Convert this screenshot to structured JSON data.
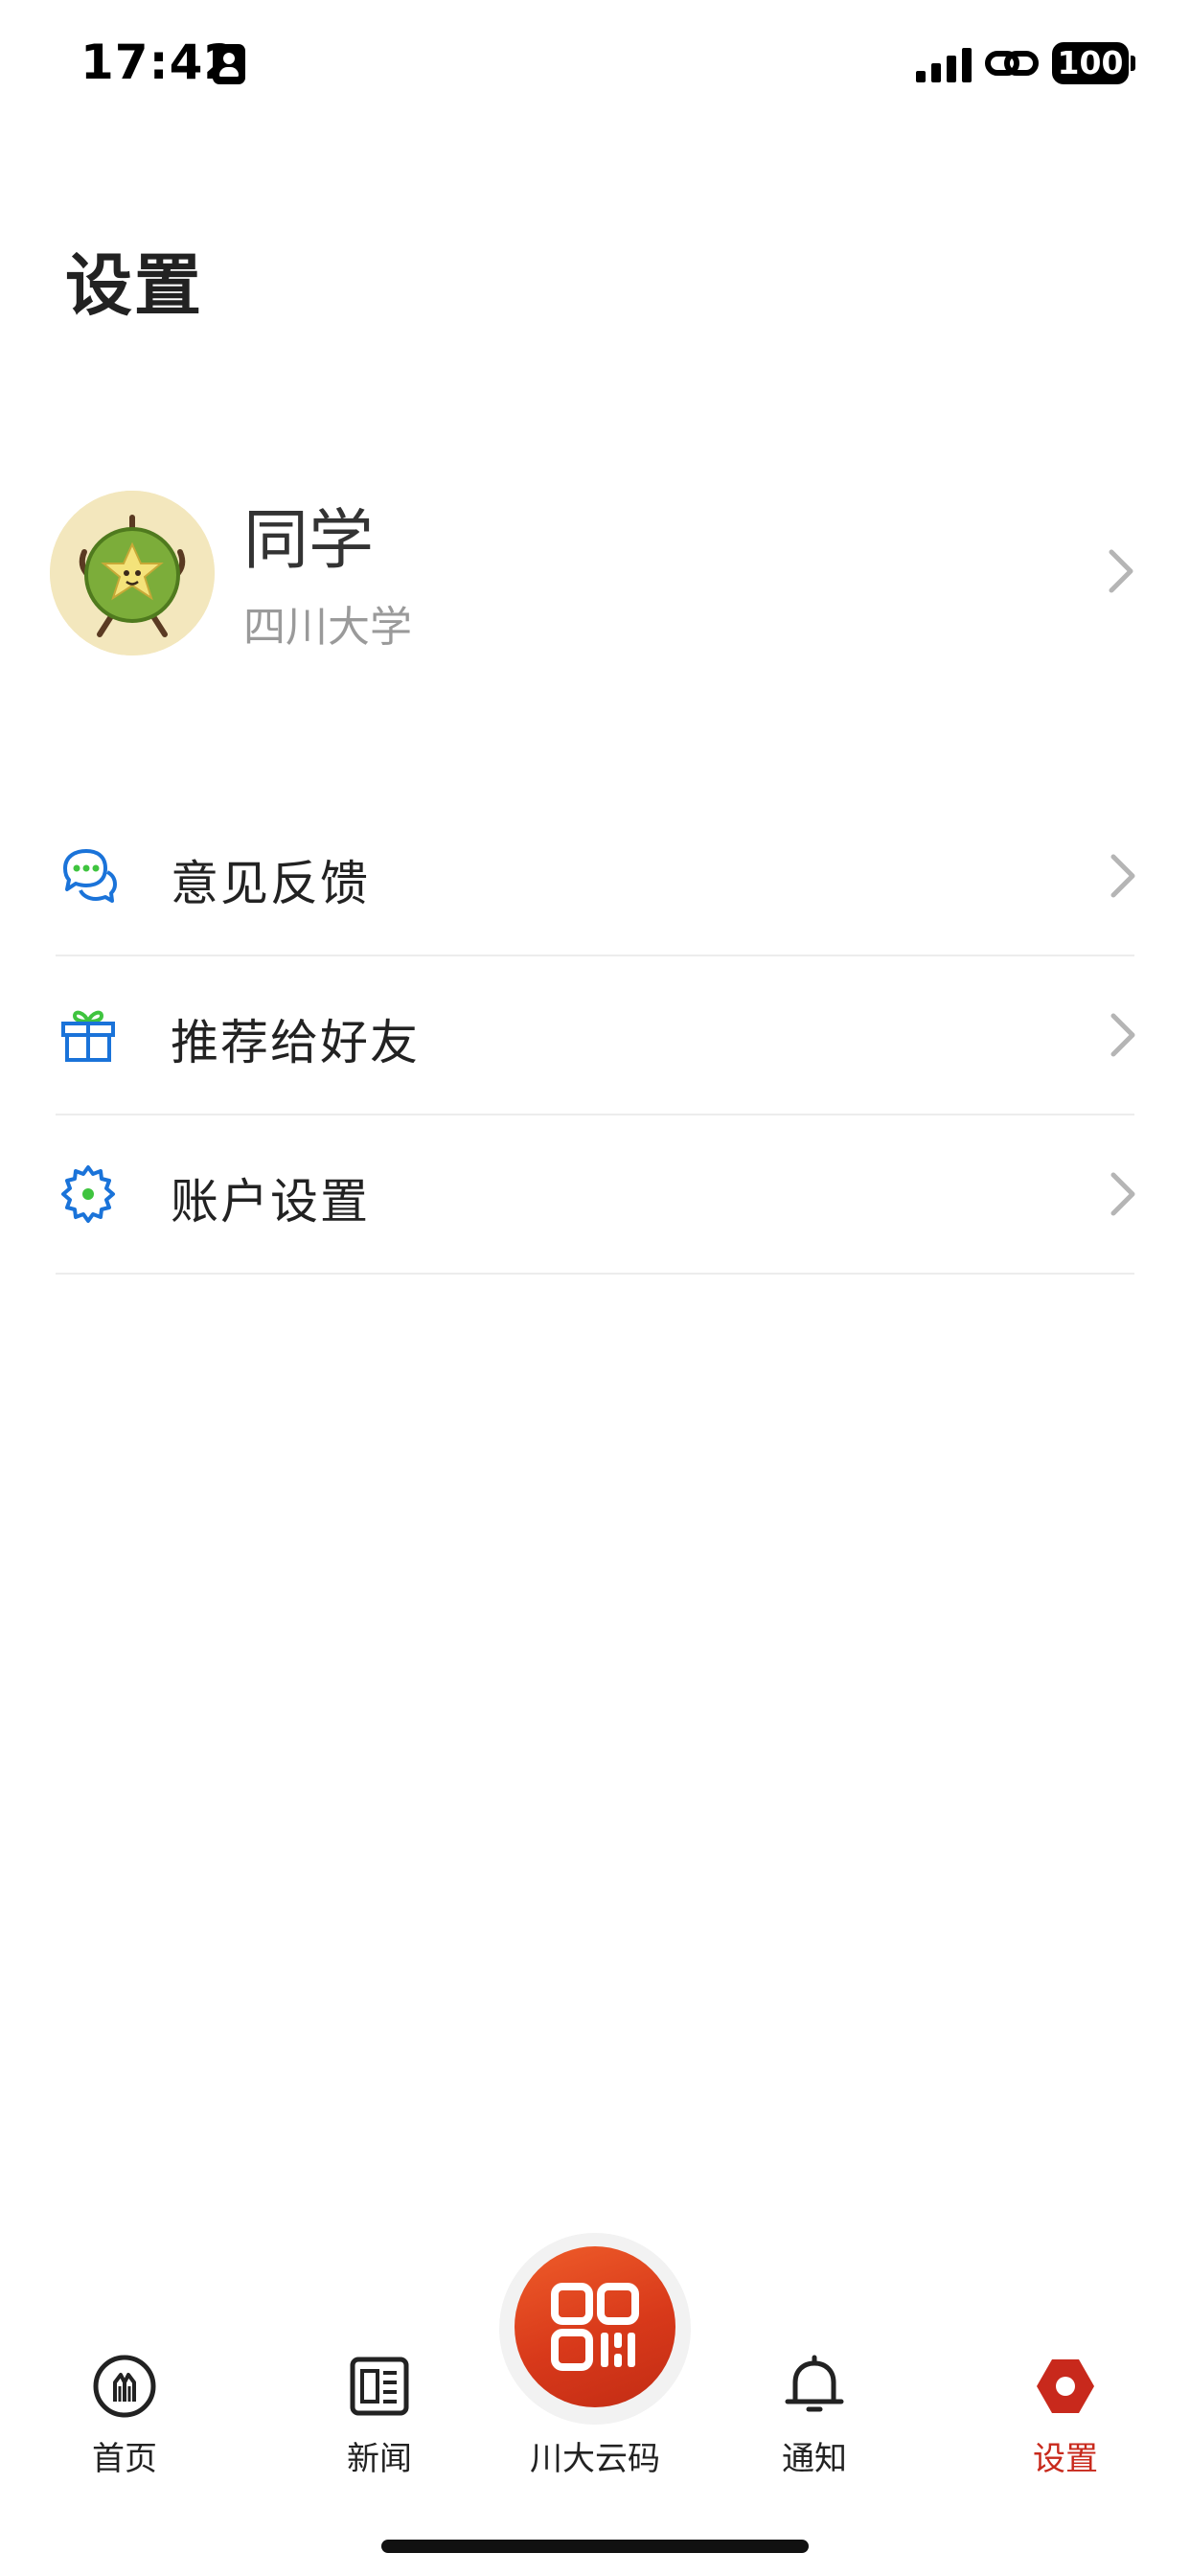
{
  "status_bar": {
    "time": "17:42",
    "battery": "100"
  },
  "page": {
    "title": "设置"
  },
  "profile": {
    "name": "同学",
    "school": "四川大学"
  },
  "menu": [
    {
      "label": "意见反馈",
      "icon": "chat-bubbles-icon"
    },
    {
      "label": "推荐给好友",
      "icon": "gift-icon"
    },
    {
      "label": "账户设置",
      "icon": "gear-icon"
    }
  ],
  "tabs": [
    {
      "label": "首页",
      "icon": "campus-logo-icon"
    },
    {
      "label": "新闻",
      "icon": "news-icon"
    },
    {
      "label": "川大云码",
      "icon": "qr-code-icon"
    },
    {
      "label": "通知",
      "icon": "bell-icon"
    },
    {
      "label": "设置",
      "icon": "settings-icon",
      "active": true
    }
  ],
  "colors": {
    "accent": "#c8291c",
    "qr_button": "#e0461f",
    "menu_icon_blue": "#1a73d9",
    "menu_icon_green": "#3fc43f"
  }
}
